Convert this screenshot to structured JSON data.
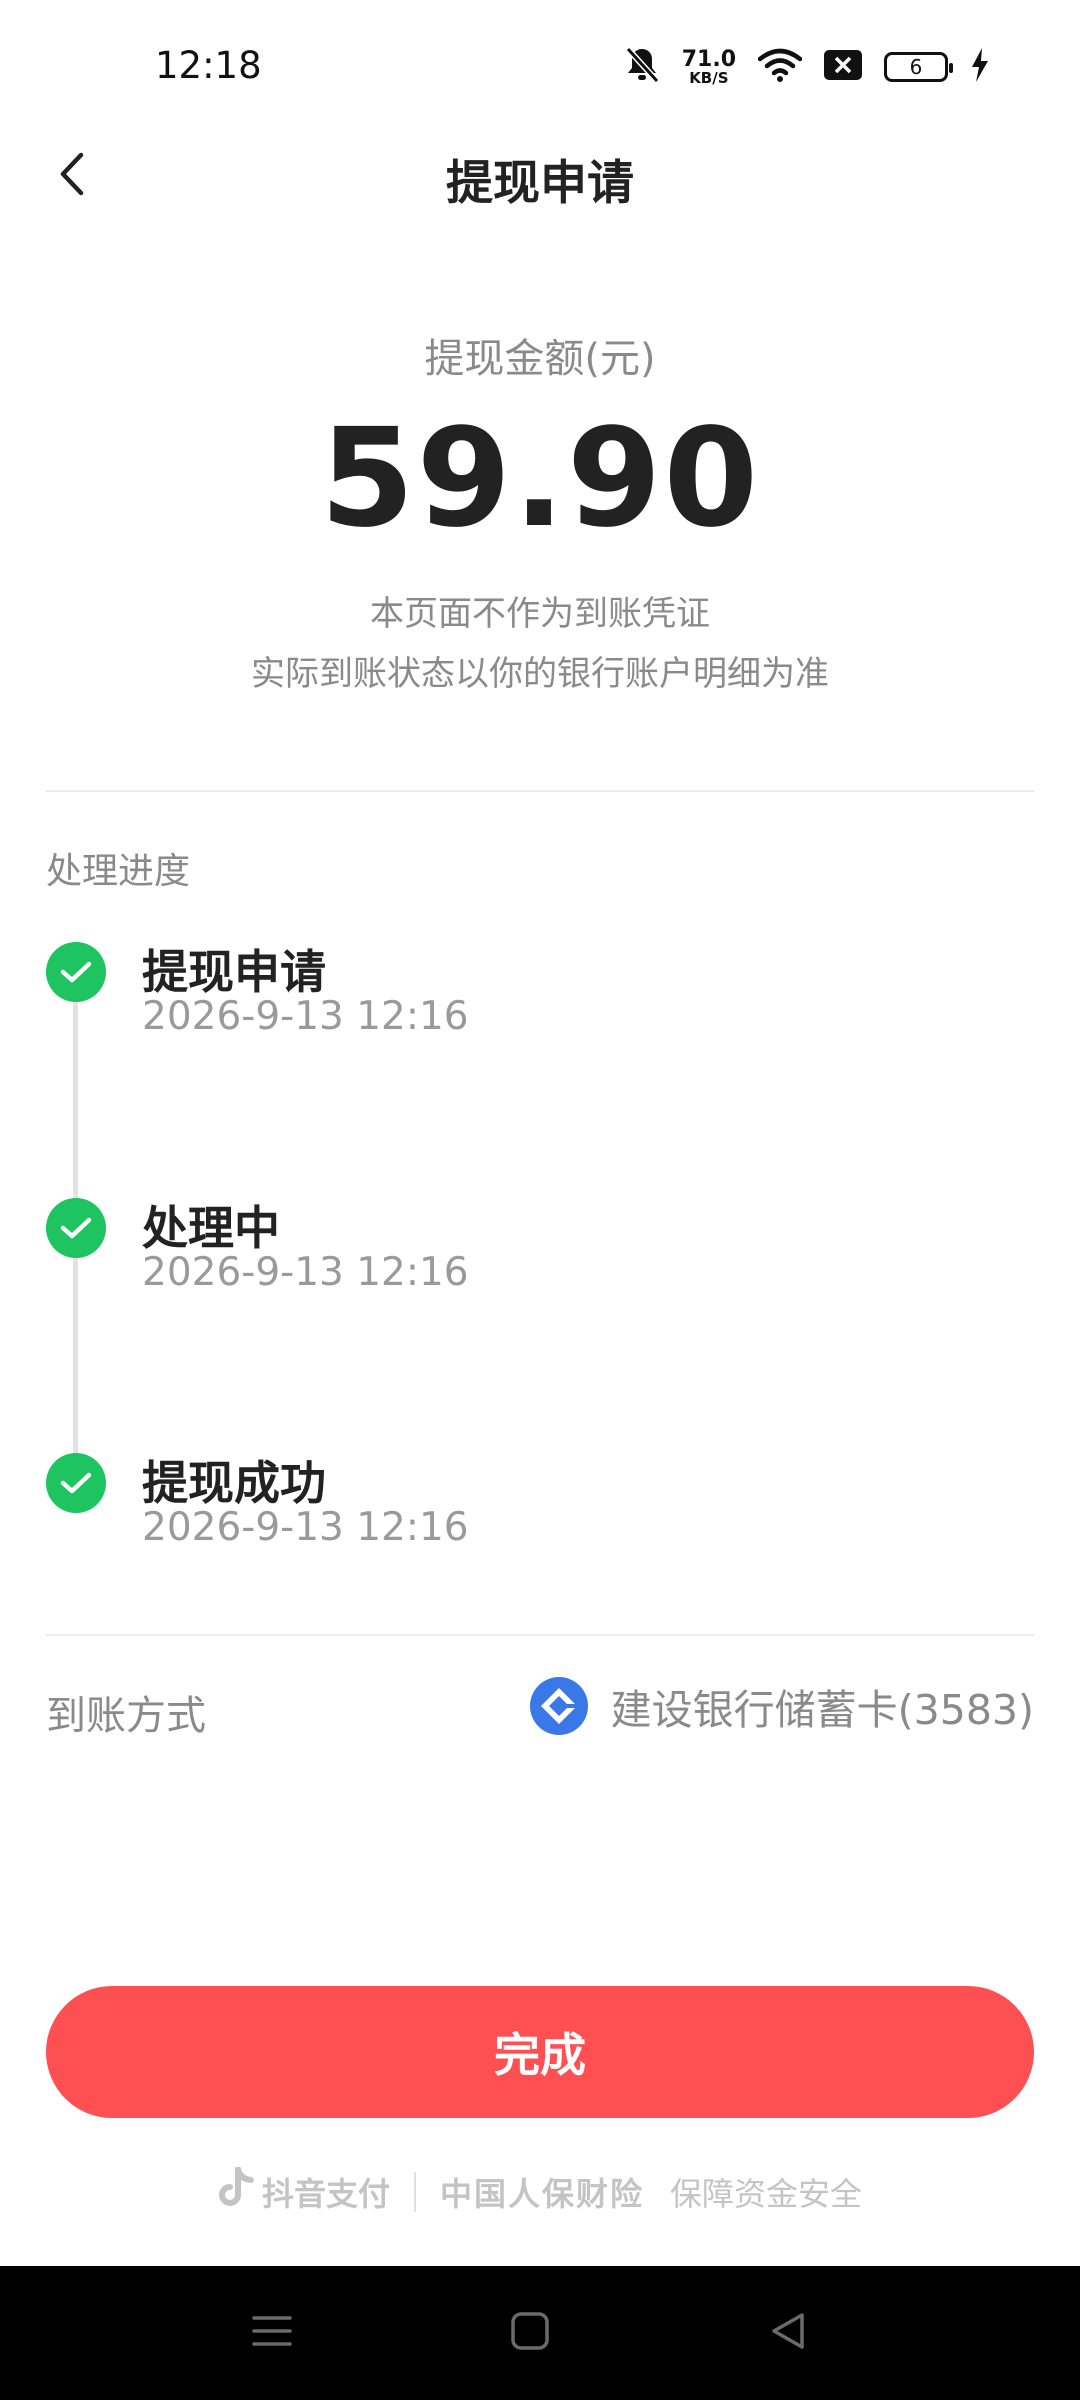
{
  "status_bar": {
    "time": "12:18",
    "net_speed_value": "71.0",
    "net_speed_unit": "KB/S",
    "battery_level": "6",
    "icons": [
      "bell-muted-icon",
      "wifi-icon",
      "sim-off-icon",
      "battery-icon",
      "charging-icon"
    ]
  },
  "header": {
    "title": "提现申请",
    "back_icon": "chevron-left-icon"
  },
  "amount": {
    "label": "提现金额(元)",
    "value": "59.90",
    "note_line1": "本页面不作为到账凭证",
    "note_line2": "实际到账状态以你的银行账户明细为准"
  },
  "progress": {
    "section_title": "处理进度",
    "steps": [
      {
        "label": "提现申请",
        "time": "2026-9-13 12:16",
        "status": "done"
      },
      {
        "label": "处理中",
        "time": "2026-9-13 12:16",
        "status": "done"
      },
      {
        "label": "提现成功",
        "time": "2026-9-13 12:16",
        "status": "done"
      }
    ]
  },
  "payout": {
    "label": "到账方式",
    "bank": "建设银行储蓄卡(3583)",
    "bank_icon": "ccb-bank-logo-icon"
  },
  "done_button": {
    "label": "完成"
  },
  "footer": {
    "pay_brand": "抖音支付",
    "insurer": "中国人保财险",
    "slogan": "保障资金安全"
  },
  "colors": {
    "accent_button": "#fe4f53",
    "success_green": "#1dc45f",
    "bank_blue": "#3b78e7",
    "muted_text": "#8a8a8a"
  }
}
